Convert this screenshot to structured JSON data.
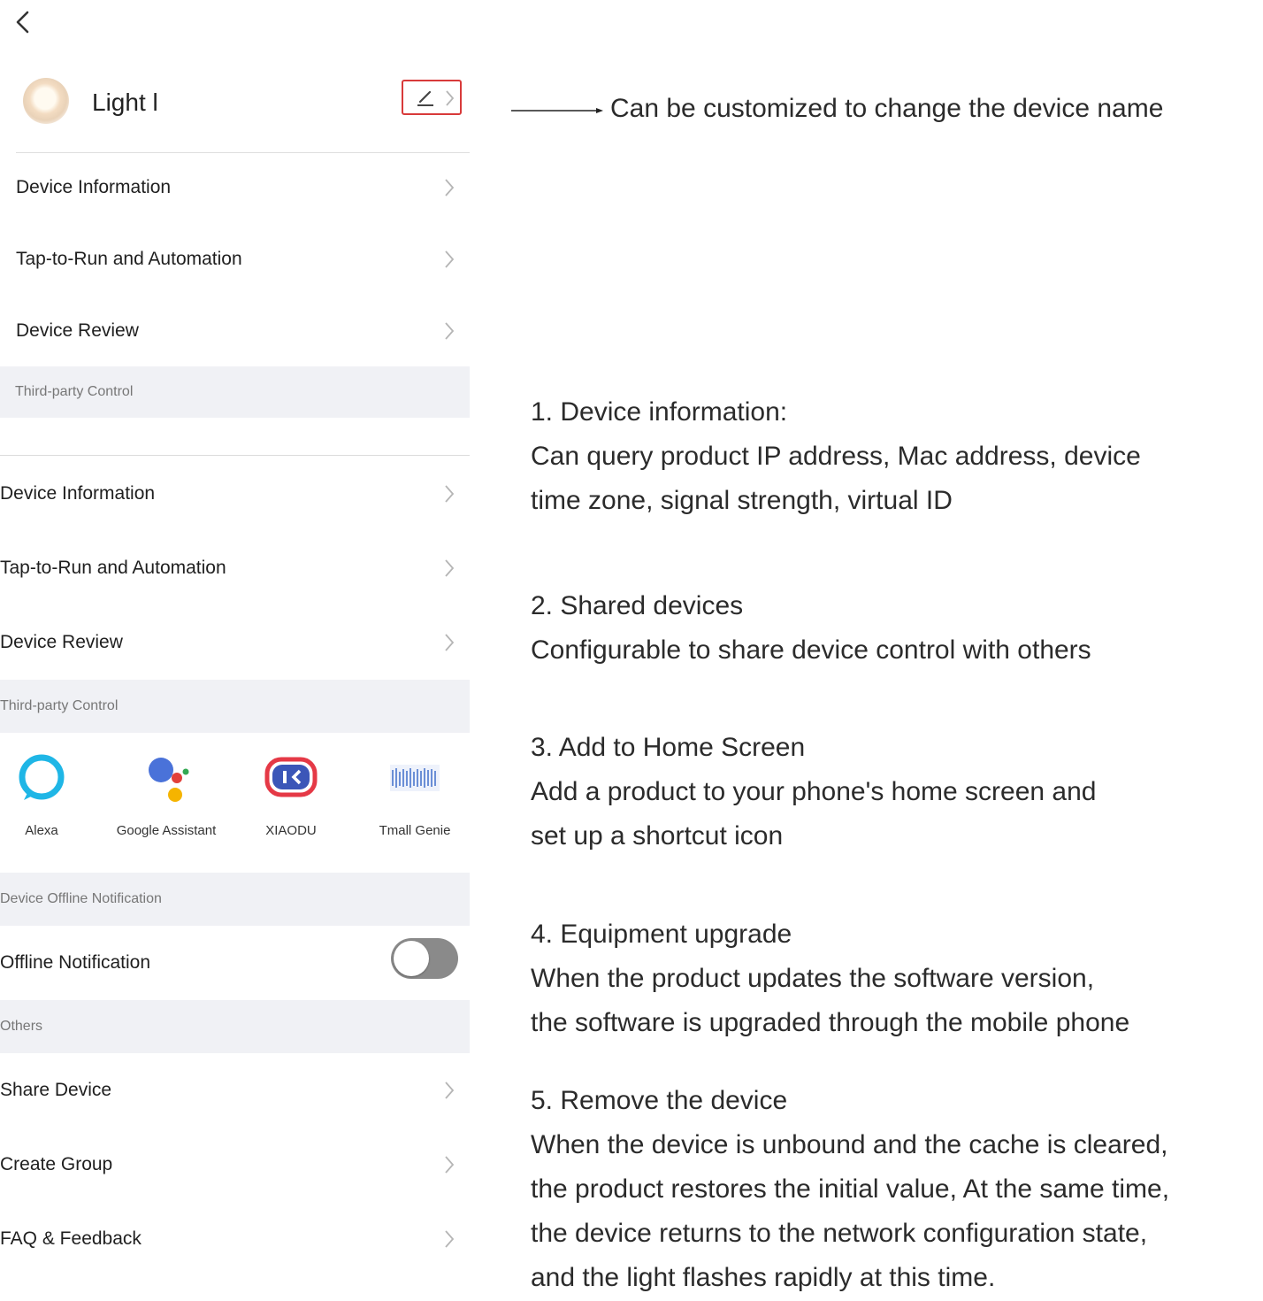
{
  "screen": {
    "device_name": "Light l",
    "top_list": [
      {
        "label": "Device Information"
      },
      {
        "label": "Tap-to-Run and Automation"
      },
      {
        "label": "Device Review"
      }
    ],
    "top_section_label": "Third-party Control",
    "main_list": [
      {
        "label": "Device Information"
      },
      {
        "label": "Tap-to-Run and Automation"
      },
      {
        "label": "Device Review"
      }
    ],
    "third_party_section_label": "Third-party Control",
    "third_party_services": [
      {
        "label": "Alexa",
        "icon": "alexa-icon"
      },
      {
        "label": "Google Assistant",
        "icon": "google-assistant-icon"
      },
      {
        "label": "XIAODU",
        "icon": "xiaodu-icon"
      },
      {
        "label": "Tmall Genie",
        "icon": "tmall-genie-icon"
      }
    ],
    "offline_section_label": "Device Offline Notification",
    "offline_notification_label": "Offline Notification",
    "offline_notification_enabled": false,
    "others_section_label": "Others",
    "others_list": [
      {
        "label": "Share Device"
      },
      {
        "label": "Create Group"
      },
      {
        "label": "FAQ & Feedback"
      }
    ]
  },
  "annotations": {
    "rename_note": "Can be customized to change the device name",
    "notes": [
      {
        "title": "1. Device information:",
        "lines": [
          "Can query product IP address, Mac address, device",
          "time zone, signal strength, virtual ID"
        ]
      },
      {
        "title": "2. Shared devices",
        "lines": [
          "Configurable to share device control with others"
        ]
      },
      {
        "title": "3. Add to Home Screen",
        "lines": [
          "Add a product to your phone's home screen and",
          "set up a shortcut icon"
        ]
      },
      {
        "title": "4. Equipment upgrade",
        "lines": [
          "When the product updates the software version,",
          "the software is upgraded through the mobile phone"
        ]
      },
      {
        "title": "5. Remove the device",
        "lines": [
          "When the device is unbound and the cache is cleared,",
          "the product restores the initial value, At the same time,",
          "the device returns to the network configuration state,",
          "and the light flashes rapidly at this time."
        ]
      }
    ]
  },
  "colors": {
    "edit_highlight": "#d83a3a",
    "section_background": "#f0f1f5",
    "toggle_off": "#8a8a8a",
    "alexa_blue": "#1fb6e6",
    "xiaodu_red": "#e53946",
    "tmall_blue": "#6b8fd6"
  }
}
